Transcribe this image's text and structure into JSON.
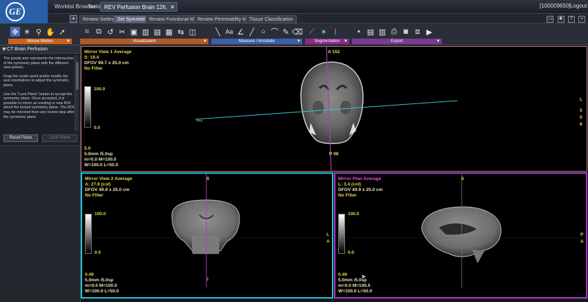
{
  "app": {
    "logo_text": "GE",
    "top_tabs": [
      "Worklist Browser",
      "Tools",
      "REV Perfusion Brain 126,"
    ],
    "close_glyph": "✕",
    "user": "[100009650]",
    "logout": "Logout"
  },
  "step_tabs": [
    "Review Settings",
    "Set Symmetry",
    "Review Functional Maps",
    "Review Permeability Maps",
    "Tissue Classification"
  ],
  "add_tab": "+",
  "toolbar": {
    "groups": [
      {
        "label": "Mouse Modes",
        "icons": [
          "move-arrows-icon",
          "brightness-icon",
          "zoom-icon",
          "pan-hand-icon",
          "pointer-icon"
        ]
      },
      {
        "label": "Visualization",
        "icons": [
          "crop-icon",
          "layout-icon",
          "reset-icon",
          "grid-icon",
          "flip-icon"
        ]
      },
      {
        "label": "Measure / Annotate",
        "icons": [
          "line-icon",
          "text-icon",
          "angle-icon",
          "curve-icon",
          "ellipse-icon",
          "spline-icon",
          "eraser-icon"
        ]
      },
      {
        "label": "Segmentation",
        "icons": [
          "seg-line-icon",
          "seg-wand-icon",
          "seg-brush-icon"
        ]
      },
      {
        "label": "Export",
        "icons": [
          "save-icon",
          "report-icon",
          "film-icon",
          "print-icon",
          "camera-icon",
          "export-image-icon",
          "movie-icon"
        ]
      }
    ]
  },
  "sidebar": {
    "title": "CT Brain Perfusion",
    "paragraphs": [
      "The purple axis represents the intersection of the symmetry plane with the different view planes.",
      "Drag the center point and/or modify the axis orientations to adjust the symmetry plane.",
      "Use the \"Lock Plane\" button to accept the symmetry plane. Once accepted, it is possible to mirror an existing or new ROI about the locked symmetry plane. The ROI may be mirrored from any review step after the symmetry plane"
    ],
    "reset_button": "Reset Plane",
    "lock_button": "Lock Plane"
  },
  "viewports": {
    "vp1": {
      "title": "Mirror View 1 Average",
      "pos": "S: 19.4",
      "dfov": "DFOV 99.7 x 25.0 cm",
      "filter": "No Filter",
      "top_label": "A 152",
      "bottom_label": "P 98",
      "right_labels": [
        "L",
        "5",
        "0",
        "8"
      ],
      "scale_max": "100.0",
      "scale_min": "0.0",
      "thickness_val": "5.0",
      "thickness": "5.0mm /5.0sp",
      "mm": "m=0.0 M=100.0",
      "wl": "W=100.0 L=50.0"
    },
    "vp2": {
      "title": "Mirror View 2 Average",
      "pos": "A: 27.8 (col)",
      "dfov": "DFOV 49.9 x 25.0 cm",
      "filter": "No Filter",
      "top_label": "S",
      "bottom_label": "I",
      "right_labels": [
        "L",
        "A"
      ],
      "scale_max": "100.0",
      "scale_min": "0.0",
      "thickness_val": "0.49",
      "thickness": "5.0mm /5.0sp",
      "mm": "m=0.0 M=100.0",
      "wl": "W=100.0 L=50.0"
    },
    "vp3": {
      "title": "Mirror Plan Average",
      "pos": "L: 3.4 (col)",
      "dfov": "DFOV 49.9 x 25.0 cm",
      "filter": "No Filter",
      "top_label": "S",
      "right_labels": [
        "P",
        "A"
      ],
      "scale_max": "100.0",
      "scale_min": "0.0",
      "thickness_val": "0.49",
      "thickness": "5.0mm /5.0sp",
      "mm": "m=0.0 M=100.0",
      "wl": "W=100.0 L=50.0"
    }
  },
  "colors": {
    "vp1_border": "#c77b8a",
    "vp2_border": "#22c8d8",
    "vp3_border": "#b237c9",
    "overlay_text": "#e8d84a"
  }
}
